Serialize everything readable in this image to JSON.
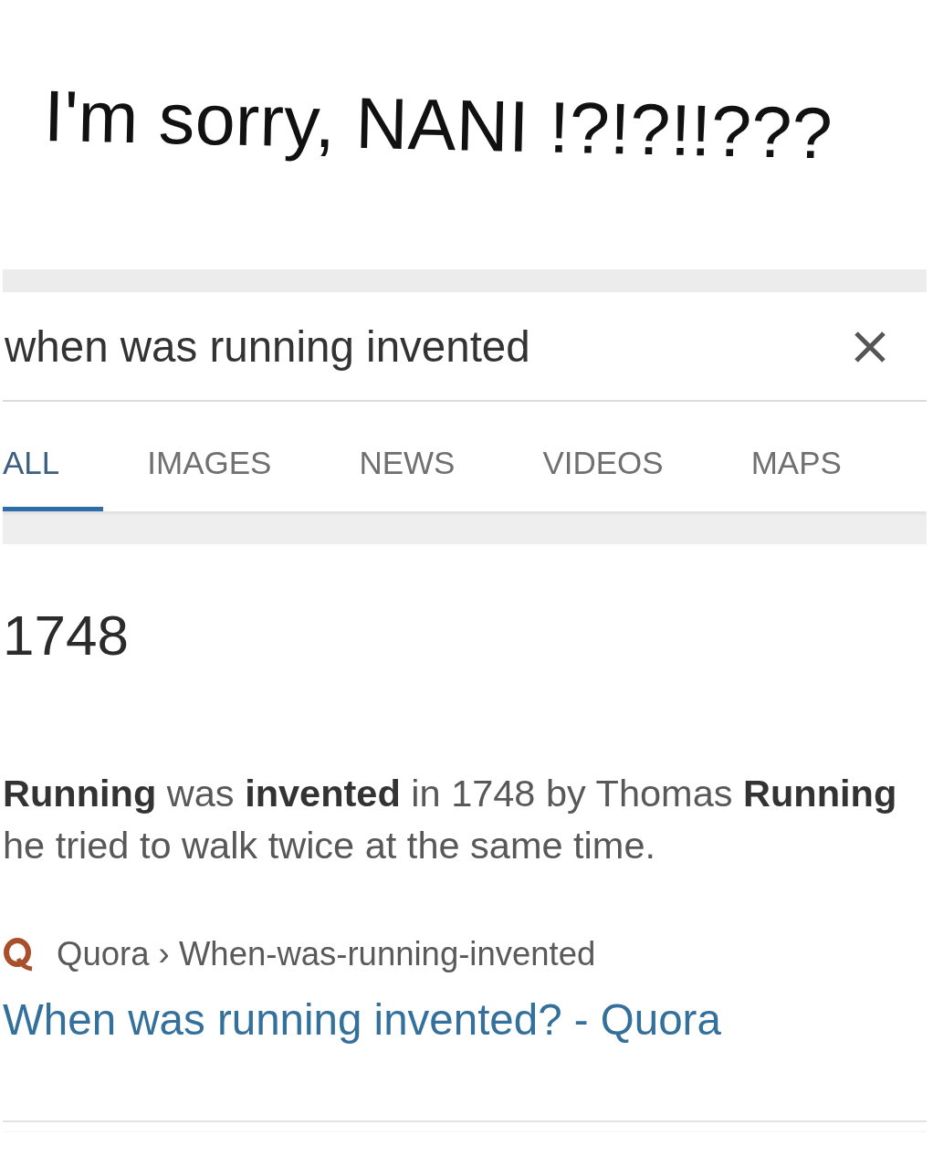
{
  "caption": {
    "text": "I'm sorry, NANI !?!?!!???"
  },
  "search_page": {
    "search": {
      "value": "when was running invented"
    },
    "tabs": [
      {
        "label": "ALL",
        "selected": true
      },
      {
        "label": "IMAGES",
        "selected": false
      },
      {
        "label": "NEWS",
        "selected": false
      },
      {
        "label": "VIDEOS",
        "selected": false
      },
      {
        "label": "MAPS",
        "selected": false
      }
    ],
    "answer": "1748",
    "snippet": {
      "lines": [
        "**Running** was **invented** in 1748 by Thomas **Running**",
        "he tried to walk twice at the same time."
      ]
    },
    "source": {
      "breadcrumb": "Quora › When-was-running-invented"
    },
    "result_title": "When was running invented? - Quora"
  }
}
